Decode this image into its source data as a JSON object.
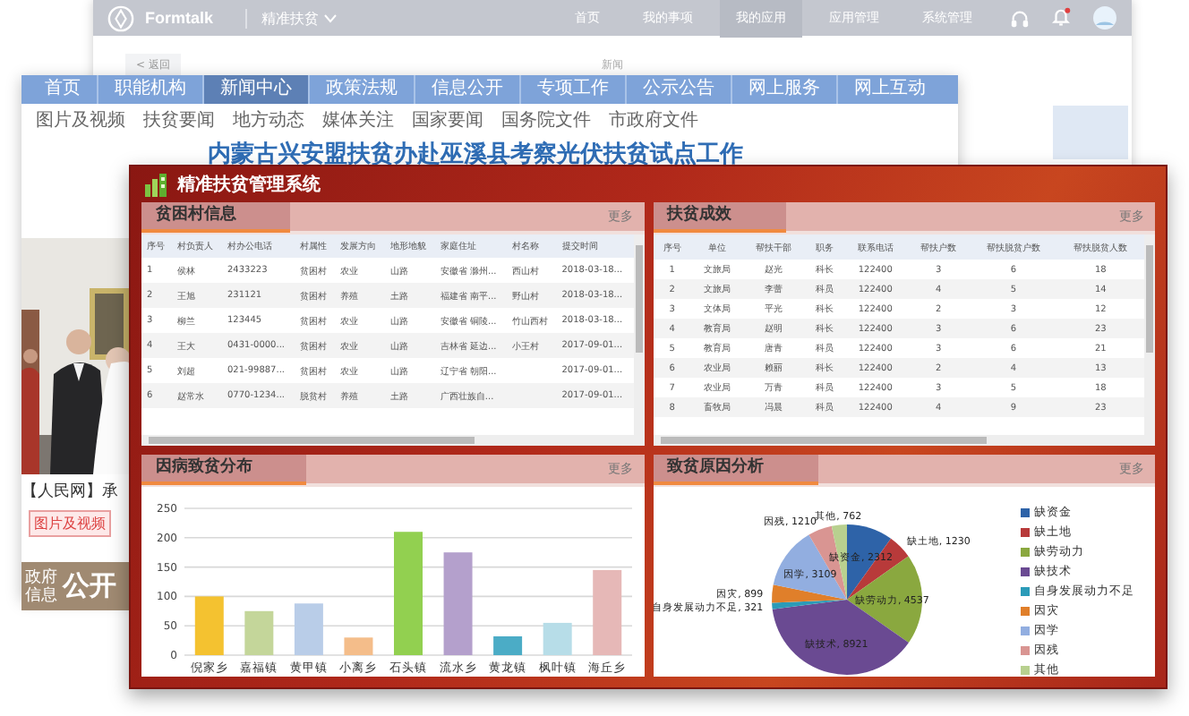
{
  "back_window": {
    "brand": "Formtalk",
    "app_switcher": "精准扶贫",
    "nav": [
      {
        "label": "首页",
        "selected": false
      },
      {
        "label": "我的事项",
        "selected": false
      },
      {
        "label": "我的应用",
        "selected": true
      },
      {
        "label": "应用管理",
        "selected": false
      },
      {
        "label": "系统管理",
        "selected": false
      }
    ],
    "back_link": "< 返回",
    "page_title": "新闻"
  },
  "gov_site": {
    "nav": [
      {
        "label": "首页",
        "selected": false
      },
      {
        "label": "职能机构",
        "selected": false
      },
      {
        "label": "新闻中心",
        "selected": true
      },
      {
        "label": "政策法规",
        "selected": false
      },
      {
        "label": "信息公开",
        "selected": false
      },
      {
        "label": "专项工作",
        "selected": false
      },
      {
        "label": "公示公告",
        "selected": false
      },
      {
        "label": "网上服务",
        "selected": false
      },
      {
        "label": "网上互动",
        "selected": false
      }
    ],
    "subnav": [
      "图片及视频",
      "扶贫要闻",
      "地方动态",
      "媒体关注",
      "国家要闻",
      "国务院文件",
      "市政府文件"
    ],
    "headline": "内蒙古兴安盟扶贫办赴巫溪县考察光伏扶贫试点工作",
    "caption": "【人民网】承",
    "tag_button": "图片及视频",
    "banner": {
      "small": [
        "政府",
        "信息"
      ],
      "big": "公开"
    }
  },
  "dashboard": {
    "title": "精准扶贫管理系统",
    "panels": [
      {
        "kind": "table",
        "title": "贫困村信息",
        "more": "更多",
        "columns": [
          "序号",
          "村负责人",
          "村办公电话",
          "村属性",
          "发展方向",
          "地形地貌",
          "家庭住址",
          "村名称",
          "提交时间"
        ],
        "rows": [
          [
            "1",
            "侯林",
            "2433223",
            "贫困村",
            "农业",
            "山路",
            "安徽省 滁州...",
            "西山村",
            "2018-03-18..."
          ],
          [
            "2",
            "王旭",
            "231121",
            "贫困村",
            "养殖",
            "土路",
            "福建省 南平...",
            "野山村",
            "2018-03-18..."
          ],
          [
            "3",
            "柳兰",
            "123445",
            "贫困村",
            "农业",
            "山路",
            "安徽省 铜陵...",
            "竹山西村",
            "2018-03-18..."
          ],
          [
            "4",
            "王大",
            "0431-0000...",
            "贫困村",
            "农业",
            "山路",
            "吉林省 延边...",
            "小王村",
            "2017-09-01..."
          ],
          [
            "5",
            "刘超",
            "021-99887...",
            "贫困村",
            "农业",
            "山路",
            "辽宁省 朝阳...",
            null,
            "2017-09-01..."
          ],
          [
            "6",
            "赵常水",
            "0770-1234...",
            "脱贫村",
            "养殖",
            "土路",
            "广西壮族自...",
            null,
            "2017-09-01..."
          ]
        ]
      },
      {
        "kind": "table",
        "title": "扶贫成效",
        "more": "更多",
        "columns": [
          "序号",
          "单位",
          "帮扶干部",
          "职务",
          "联系电话",
          "帮扶户数",
          "帮扶脱贫户数",
          "帮扶脱贫人数"
        ],
        "rows": [
          [
            "1",
            "文旅局",
            "赵光",
            "科长",
            "122400",
            "3",
            "6",
            "18"
          ],
          [
            "2",
            "文旅局",
            "李蕾",
            "科员",
            "122400",
            "4",
            "5",
            "14"
          ],
          [
            "3",
            "文体局",
            "平光",
            "科长",
            "122400",
            "2",
            "3",
            "12"
          ],
          [
            "4",
            "教育局",
            "赵明",
            "科长",
            "122400",
            "3",
            "6",
            "23"
          ],
          [
            "5",
            "教育局",
            "唐青",
            "科员",
            "122400",
            "3",
            "6",
            "21"
          ],
          [
            "6",
            "农业局",
            "赖丽",
            "科长",
            "122400",
            "2",
            "4",
            "13"
          ],
          [
            "7",
            "农业局",
            "万青",
            "科员",
            "122400",
            "3",
            "5",
            "18"
          ],
          [
            "8",
            "畜牧局",
            "冯晨",
            "科员",
            "122400",
            "4",
            "9",
            "23"
          ]
        ]
      },
      {
        "kind": "chart",
        "title": "因病致贫分布",
        "more": "更多",
        "chart_data": {
          "type": "bar",
          "categories": [
            "倪家乡",
            "嘉福镇",
            "黄甲镇",
            "小离乡",
            "石头镇",
            "流水乡",
            "黄龙镇",
            "枫叶镇",
            "海丘乡"
          ],
          "values": [
            100,
            75,
            88,
            30,
            210,
            175,
            32,
            55,
            145
          ],
          "ylim": [
            0,
            250
          ],
          "yticks": [
            0,
            50,
            100,
            150,
            200,
            250
          ],
          "grid": true
        },
        "bars": [
          {
            "color": "#f4c230"
          },
          {
            "color": "#c4d69a"
          },
          {
            "color": "#b9cde8"
          },
          {
            "color": "#f4bd8a"
          },
          {
            "color": "#92d050"
          },
          {
            "color": "#b4a0cc"
          },
          {
            "color": "#4bacc6"
          },
          {
            "color": "#b7dde8"
          },
          {
            "color": "#e6b8b7"
          }
        ]
      },
      {
        "kind": "chart",
        "title": "致贫原因分析",
        "more": "更多",
        "chart_data": {
          "type": "pie",
          "values": [
            2312,
            1230,
            4537,
            8921,
            321,
            899,
            3109,
            1210,
            762
          ],
          "value_labels": [
            "缺资金, 2312",
            "缺土地, 1230",
            "缺劳动力, 4537",
            "缺技术, 8921",
            "自身发展动力不足, 321",
            "因灾, 899",
            "因学, 3109",
            "因残, 1210",
            "其他, 762"
          ]
        },
        "legend": [
          {
            "label": "缺资金",
            "color": "#2e63a8"
          },
          {
            "label": "缺土地",
            "color": "#b83a3a"
          },
          {
            "label": "缺劳动力",
            "color": "#8aa83f"
          },
          {
            "label": "缺技术",
            "color": "#6a4a92"
          },
          {
            "label": "自身发展动力不足",
            "color": "#2b9bb8"
          },
          {
            "label": "因灾",
            "color": "#e07f2a"
          },
          {
            "label": "因学",
            "color": "#92aee0"
          },
          {
            "label": "因残",
            "color": "#d99592"
          },
          {
            "label": "其他",
            "color": "#b8d08f"
          }
        ]
      }
    ]
  }
}
